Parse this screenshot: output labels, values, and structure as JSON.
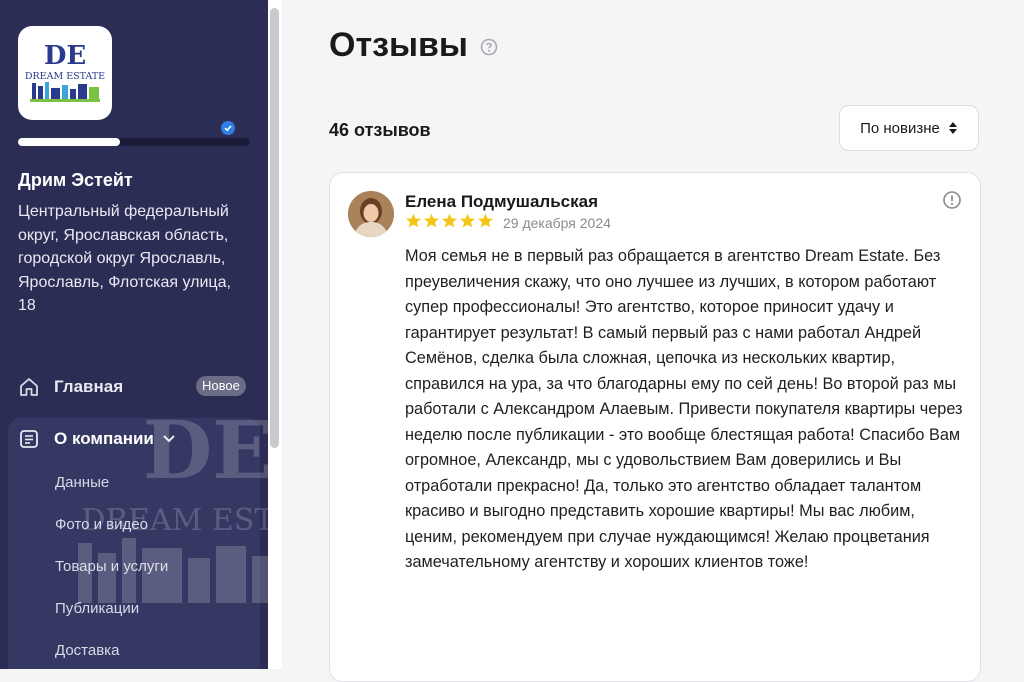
{
  "sidebar": {
    "logo": {
      "brand_top": "DE",
      "brand_text": "DREAM ESTATE"
    },
    "profile_progress": 0.44,
    "company_name": "Дрим Эстейт",
    "company_address": "Центральный федеральный округ, Ярославская область, городской округ Ярославль, Ярославль, Флотская улица, 18",
    "nav": {
      "home_label": "Главная",
      "home_badge": "Новое",
      "about_label": "О компании",
      "about_items": [
        "Данные",
        "Фото и видео",
        "Товары и услуги",
        "Публикации",
        "Доставка"
      ]
    },
    "watermark": {
      "top": "DE",
      "text": "DREAM ESTATE"
    }
  },
  "main": {
    "title": "Отзывы",
    "reviews_count": "46 отзывов",
    "sort_label": "По новизне"
  },
  "review": {
    "author": "Елена Подмушальская",
    "rating": 5,
    "date": "29 декабря 2024",
    "text": "Моя семья не в первый раз обращается в агентство Dream Estate. Без преувеличения скажу, что оно лучшее из лучших, в котором работают супер профессионалы! Это агентство, которое приносит удачу и гарантирует результат! В самый первый раз с нами работал Андрей Семёнов, сделка была сложная, цепочка из нескольких квартир, справился на ура, за что благодарны ему по сей день! Во второй раз мы работали с Александром Алаевым. Привести покупателя квартиры через неделю после публикации - это вообще блестящая работа! Спасибо Вам огромное, Александр, мы с удовольствием Вам доверились и Вы отработали прекрасно! Да, только это агентство обладает талантом красиво и выгодно представить хорошие квартиры! Мы вас любим, ценим, рекомендуем при случае нуждающимся! Желаю процветания замечательному агентству и хороших клиентов тоже!"
  },
  "colors": {
    "sidebar_bg": "#2b2d54",
    "star": "#f5c518",
    "verified": "#2e7fe8"
  }
}
